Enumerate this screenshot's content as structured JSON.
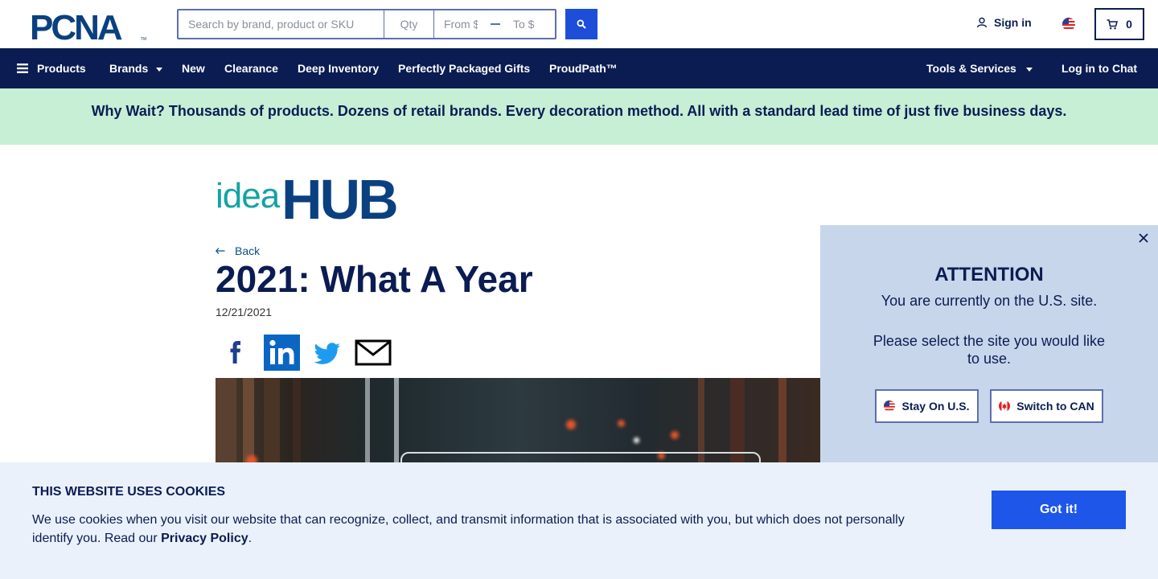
{
  "header": {
    "logo_text": "PCNA",
    "search": {
      "placeholder": "Search by brand, product or SKU",
      "value": ""
    },
    "qty": {
      "placeholder": "Qty",
      "value": ""
    },
    "price_from": {
      "placeholder": "From $",
      "value": ""
    },
    "price_to": {
      "placeholder": "To $",
      "value": ""
    },
    "sign_in_label": "Sign in",
    "cart_count": "0",
    "icons": {
      "search": "search-icon",
      "user": "user-icon",
      "flag": "us-flag-icon",
      "cart": "cart-icon"
    }
  },
  "nav": {
    "products": "Products",
    "brands": "Brands",
    "new": "New",
    "clearance": "Clearance",
    "deep_inventory": "Deep Inventory",
    "gifts": "Perfectly Packaged Gifts",
    "proudpath": "ProudPath™",
    "tools": "Tools & Services",
    "chat": "Log in to Chat"
  },
  "banner": {
    "text": "Why Wait? Thousands of products. Dozens of retail brands. Every decoration method. All with a standard lead time of just five business days."
  },
  "article": {
    "logo_idea": "idea",
    "logo_hub": "HUB",
    "back_label": "Back",
    "title": "2021: What A Year",
    "date": "12/21/2021",
    "share_icons": [
      "facebook-icon",
      "linkedin-icon",
      "twitter-icon",
      "email-icon"
    ]
  },
  "attention": {
    "title": "ATTENTION",
    "line1": "You are currently on the U.S. site.",
    "line2": "Please select the site you would like to use.",
    "stay_label": "Stay On U.S.",
    "switch_label": "Switch to CAN"
  },
  "cookies": {
    "title": "THIS WEBSITE USES COOKIES",
    "text": "We use cookies when you visit our website that can recognize, collect, and transmit information that is associated with you, but which does not personally identify you. Read our ",
    "link": "Privacy Policy",
    "period": ".",
    "button": "Got it!"
  },
  "colors": {
    "navy": "#0b1c52",
    "accent_blue": "#1d4ed8",
    "banner_green": "#c6efd6",
    "popup_bg": "#c8d6ec",
    "cookie_bg": "#eaf1fb",
    "idea_teal": "#13a3a3",
    "hub_blue": "#0a4080"
  }
}
